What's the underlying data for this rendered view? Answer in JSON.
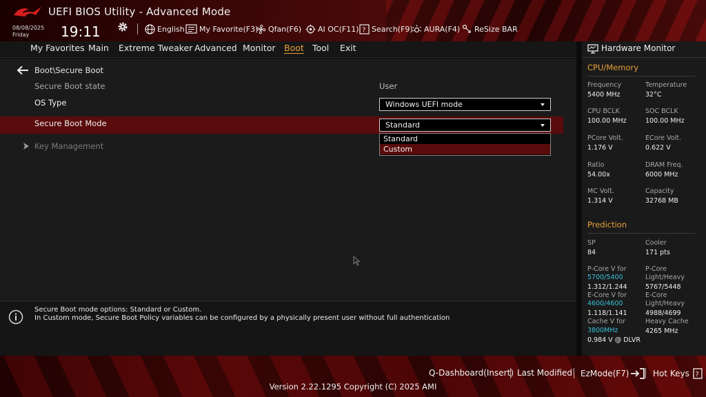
{
  "header": {
    "title": "UEFI BIOS Utility - Advanced Mode",
    "date": "08/08/2025",
    "day": "Friday",
    "time": "19:11",
    "toolbar": {
      "language": "English",
      "my_favorite": "My Favorite(F3)",
      "qfan": "Qfan(F6)",
      "ai_oc": "AI OC(F11)",
      "search": "Search(F9)",
      "aura": "AURA(F4)",
      "resize_bar": "ReSize BAR"
    }
  },
  "menu": {
    "items": [
      "My Favorites",
      "Main",
      "Extreme Tweaker",
      "Advanced",
      "Monitor",
      "Boot",
      "Tool",
      "Exit"
    ],
    "active": "Boot"
  },
  "main": {
    "breadcrumb": "Boot\\Secure Boot",
    "secure_boot_state_label": "Secure Boot state",
    "secure_boot_state_value": "User",
    "os_type_label": "OS Type",
    "os_type_value": "Windows UEFI mode",
    "secure_boot_mode_label": "Secure Boot Mode",
    "secure_boot_mode_value": "Standard",
    "dropdown_options": [
      "Standard",
      "Custom"
    ],
    "dropdown_selected": "Custom",
    "key_management_label": "Key Management"
  },
  "help": {
    "line1": "Secure Boot mode options: Standard or Custom.",
    "line2": "In Custom mode, Secure Boot Policy variables can be configured by a physically present user without full authentication"
  },
  "hw_monitor": {
    "title": "Hardware Monitor",
    "cpu_memory": {
      "heading": "CPU/Memory",
      "frequency_label": "Frequency",
      "frequency_value": "5400 MHz",
      "temperature_label": "Temperature",
      "temperature_value": "32°C",
      "cpu_bclk_label": "CPU BCLK",
      "cpu_bclk_value": "100.00 MHz",
      "soc_bclk_label": "SOC BCLK",
      "soc_bclk_value": "100.00 MHz",
      "pcore_volt_label": "PCore Volt.",
      "pcore_volt_value": "1.176 V",
      "ecore_volt_label": "ECore Volt.",
      "ecore_volt_value": "0.622 V",
      "ratio_label": "Ratio",
      "ratio_value": "54.00x",
      "dram_freq_label": "DRAM Freq.",
      "dram_freq_value": "6000 MHz",
      "mc_volt_label": "MC Volt.",
      "mc_volt_value": "1.314 V",
      "capacity_label": "Capacity",
      "capacity_value": "32768 MB"
    },
    "prediction": {
      "heading": "Prediction",
      "sp_label": "SP",
      "sp_value": "84",
      "cooler_label": "Cooler",
      "cooler_value": "171 pts",
      "pcore_v_for_label": "P-Core V for",
      "pcore_v_for_freq": "5700/5400",
      "pcore_v_for_value": "1.312/1.244",
      "pcore_lh_label1": "P-Core",
      "pcore_lh_label2": "Light/Heavy",
      "pcore_lh_value": "5767/5448",
      "ecore_v_for_label": "E-Core V for",
      "ecore_v_for_freq": "4600/4600",
      "ecore_v_for_value": "1.118/1.141",
      "ecore_lh_label1": "E-Core",
      "ecore_lh_label2": "Light/Heavy",
      "ecore_lh_value": "4988/4699",
      "cache_v_for_label": "Cache V for",
      "cache_v_for_freq": "3800MHz",
      "cache_v_for_value": "0.984 V @ DLVR",
      "heavy_cache_label": "Heavy Cache",
      "heavy_cache_value": "4265 MHz"
    }
  },
  "footer": {
    "q_dashboard": "Q-Dashboard(Insert)",
    "last_modified": "Last Modified",
    "ezmode": "EzMode(F7)",
    "hot_keys": "Hot Keys",
    "version": "Version 2.22.1295 Copyright (C) 2025 AMI"
  },
  "colors": {
    "accent": "#e8a23a",
    "highlight": "#5a0b0b",
    "cyan": "#38c0d8"
  }
}
